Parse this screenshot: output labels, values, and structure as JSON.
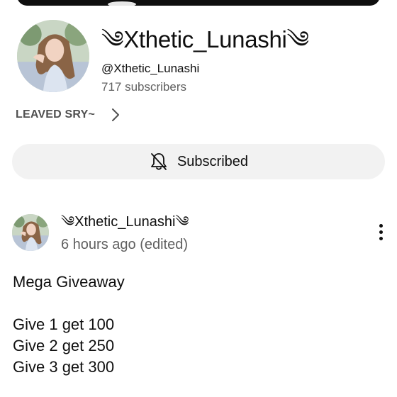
{
  "channel": {
    "name": "༄Xthetic_Lunashi༄",
    "handle": "@Xthetic_Lunashi",
    "subscribers": "717 subscribers",
    "description": "LEAVED SRY~",
    "subscribe_label": "Subscribed"
  },
  "post": {
    "author": "༄Xthetic_Lunashi༄",
    "time": "6 hours ago (edited)",
    "title": "Mega Giveaway",
    "lines": [
      "Give 1 get 100",
      "Give 2 get 250",
      "Give 3 get 300"
    ]
  },
  "icons": {
    "subscribe": "bell-off-icon",
    "description_more": "chevron-right-icon",
    "post_menu": "more-vertical-icon"
  },
  "colors": {
    "subscribe_bg": "#f2f2f2",
    "secondary_text": "#606060"
  }
}
